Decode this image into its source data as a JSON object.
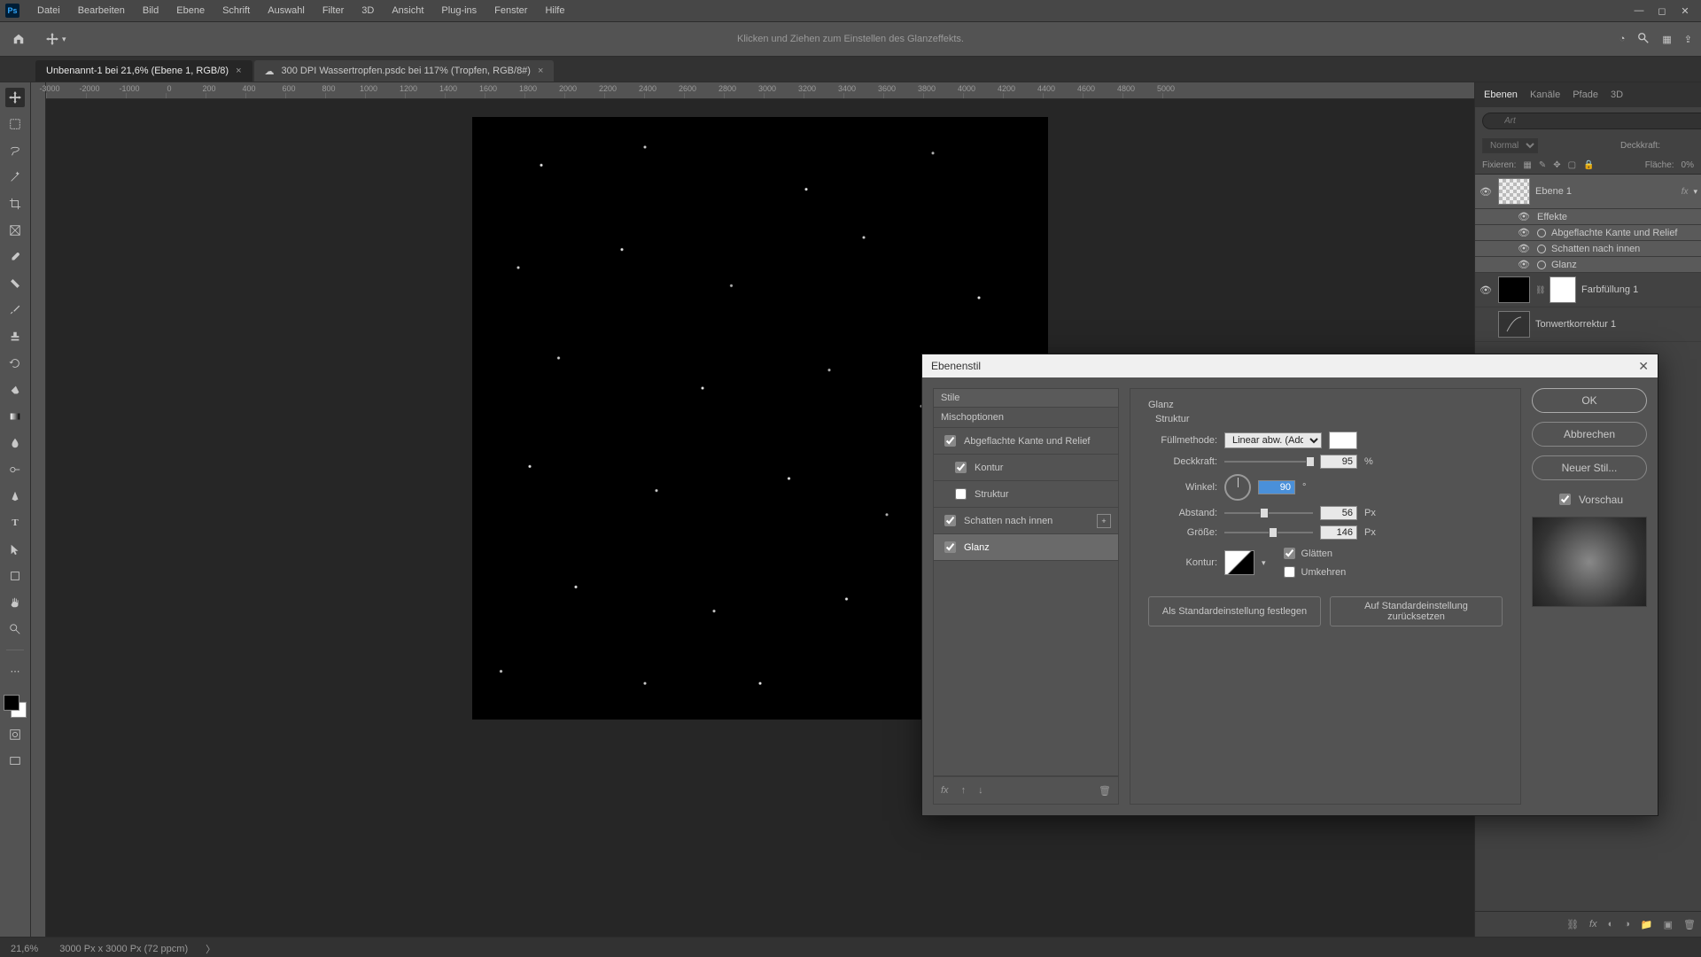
{
  "menu": {
    "items": [
      "Datei",
      "Bearbeiten",
      "Bild",
      "Ebene",
      "Schrift",
      "Auswahl",
      "Filter",
      "3D",
      "Ansicht",
      "Plug-ins",
      "Fenster",
      "Hilfe"
    ]
  },
  "optionbar": {
    "hint": "Klicken und Ziehen zum Einstellen des Glanzeffekts."
  },
  "tabs": [
    {
      "label": "Unbenannt-1 bei 21,6% (Ebene 1, RGB/8)",
      "active": true,
      "close": "×"
    },
    {
      "label": "300 DPI Wassertropfen.psdc bei 117% (Tropfen, RGB/8#)",
      "active": false,
      "close": "×",
      "cloud": true
    }
  ],
  "ruler": [
    "-3000",
    "-2000",
    "-1000",
    "0",
    "200",
    "400",
    "600",
    "800",
    "1000",
    "1200",
    "1400",
    "1600",
    "1800",
    "2000",
    "2200",
    "2400",
    "2600",
    "2800",
    "3000",
    "3200",
    "3400",
    "3600",
    "3800",
    "4000",
    "4200",
    "4400",
    "4600",
    "4800",
    "5000"
  ],
  "rightpanel": {
    "tabs": [
      "Ebenen",
      "Kanäle",
      "Pfade",
      "3D"
    ],
    "search_ph": "Art",
    "mode": "Normal",
    "opacity_lbl": "Deckkraft:",
    "opacity_val": "",
    "lock_lbl": "Fixieren:",
    "fill_lbl": "Fläche:",
    "fill_val": "0%"
  },
  "layers": {
    "l1": {
      "name": "Ebene 1",
      "fx": "fx"
    },
    "effects_label": "Effekte",
    "fx_list": [
      "Abgeflachte Kante und Relief",
      "Schatten nach innen",
      "Glanz"
    ],
    "l2": {
      "name": "Farbfüllung 1"
    },
    "l3": {
      "name": "Tonwertkorrektur 1"
    }
  },
  "status": {
    "zoom": "21,6%",
    "info": "3000 Px x 3000 Px (72 ppcm)",
    "arrow": "〉"
  },
  "dialog": {
    "title": "Ebenenstil",
    "left": {
      "header": "Stile",
      "items": [
        {
          "label": "Mischoptionen",
          "checked": null
        },
        {
          "label": "Abgeflachte Kante und Relief",
          "checked": true
        },
        {
          "label": "Kontur",
          "checked": true,
          "sub": true
        },
        {
          "label": "Struktur",
          "checked": false,
          "sub": true
        },
        {
          "label": "Schatten nach innen",
          "checked": true,
          "plus": true
        },
        {
          "label": "Glanz",
          "checked": true,
          "sel": true
        }
      ]
    },
    "mid": {
      "heading": "Glanz",
      "sub": "Struktur",
      "blend_lbl": "Füllmethode:",
      "blend_val": "Linear abw. (Add.)",
      "opacity_lbl": "Deckkraft:",
      "opacity_val": "95",
      "opacity_unit": "%",
      "angle_lbl": "Winkel:",
      "angle_val": "90",
      "angle_unit": "°",
      "dist_lbl": "Abstand:",
      "dist_val": "56",
      "dist_unit": "Px",
      "size_lbl": "Größe:",
      "size_val": "146",
      "size_unit": "Px",
      "contour_lbl": "Kontur:",
      "smooth": "Glätten",
      "invert": "Umkehren",
      "btn_default": "Als Standardeinstellung festlegen",
      "btn_reset": "Auf Standardeinstellung zurücksetzen"
    },
    "right": {
      "ok": "OK",
      "cancel": "Abbrechen",
      "newstyle": "Neuer Stil...",
      "preview": "Vorschau"
    }
  }
}
